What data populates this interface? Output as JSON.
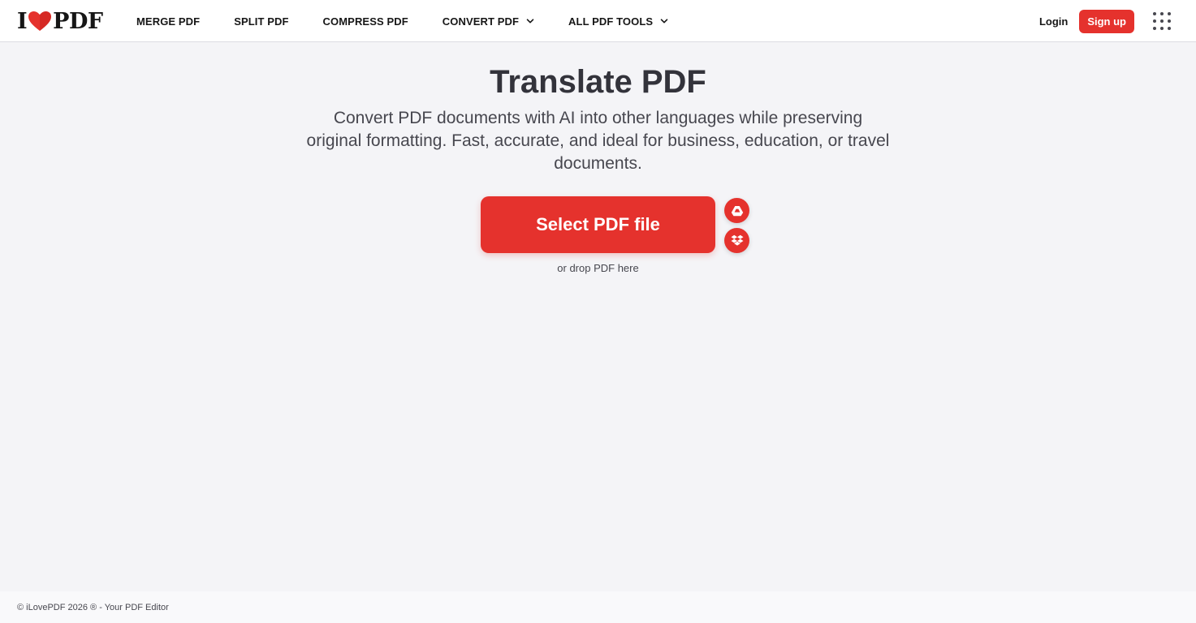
{
  "header": {
    "logo": {
      "prefix": "I",
      "suffix": "PDF"
    },
    "nav": [
      {
        "label": "MERGE PDF",
        "dropdown": false
      },
      {
        "label": "SPLIT PDF",
        "dropdown": false
      },
      {
        "label": "COMPRESS PDF",
        "dropdown": false
      },
      {
        "label": "CONVERT PDF",
        "dropdown": true
      },
      {
        "label": "ALL PDF TOOLS",
        "dropdown": true
      }
    ],
    "login_label": "Login",
    "signup_label": "Sign up",
    "apps_icon": "grid-dots-icon"
  },
  "main": {
    "title": "Translate PDF",
    "subtitle": "Convert PDF documents with AI into other languages while preserving original formatting. Fast, accurate, and ideal for business, education, or travel documents.",
    "select_button_label": "Select PDF file",
    "cloud_sources": [
      {
        "icon": "google-drive-icon"
      },
      {
        "icon": "dropbox-icon"
      }
    ],
    "drop_hint": "or drop PDF here"
  },
  "footer": {
    "copyright": "© iLovePDF 2026 ® - Your PDF Editor"
  },
  "colors": {
    "brand_red": "#e5322d",
    "background": "#f4f4f7",
    "text_dark": "#161616"
  }
}
